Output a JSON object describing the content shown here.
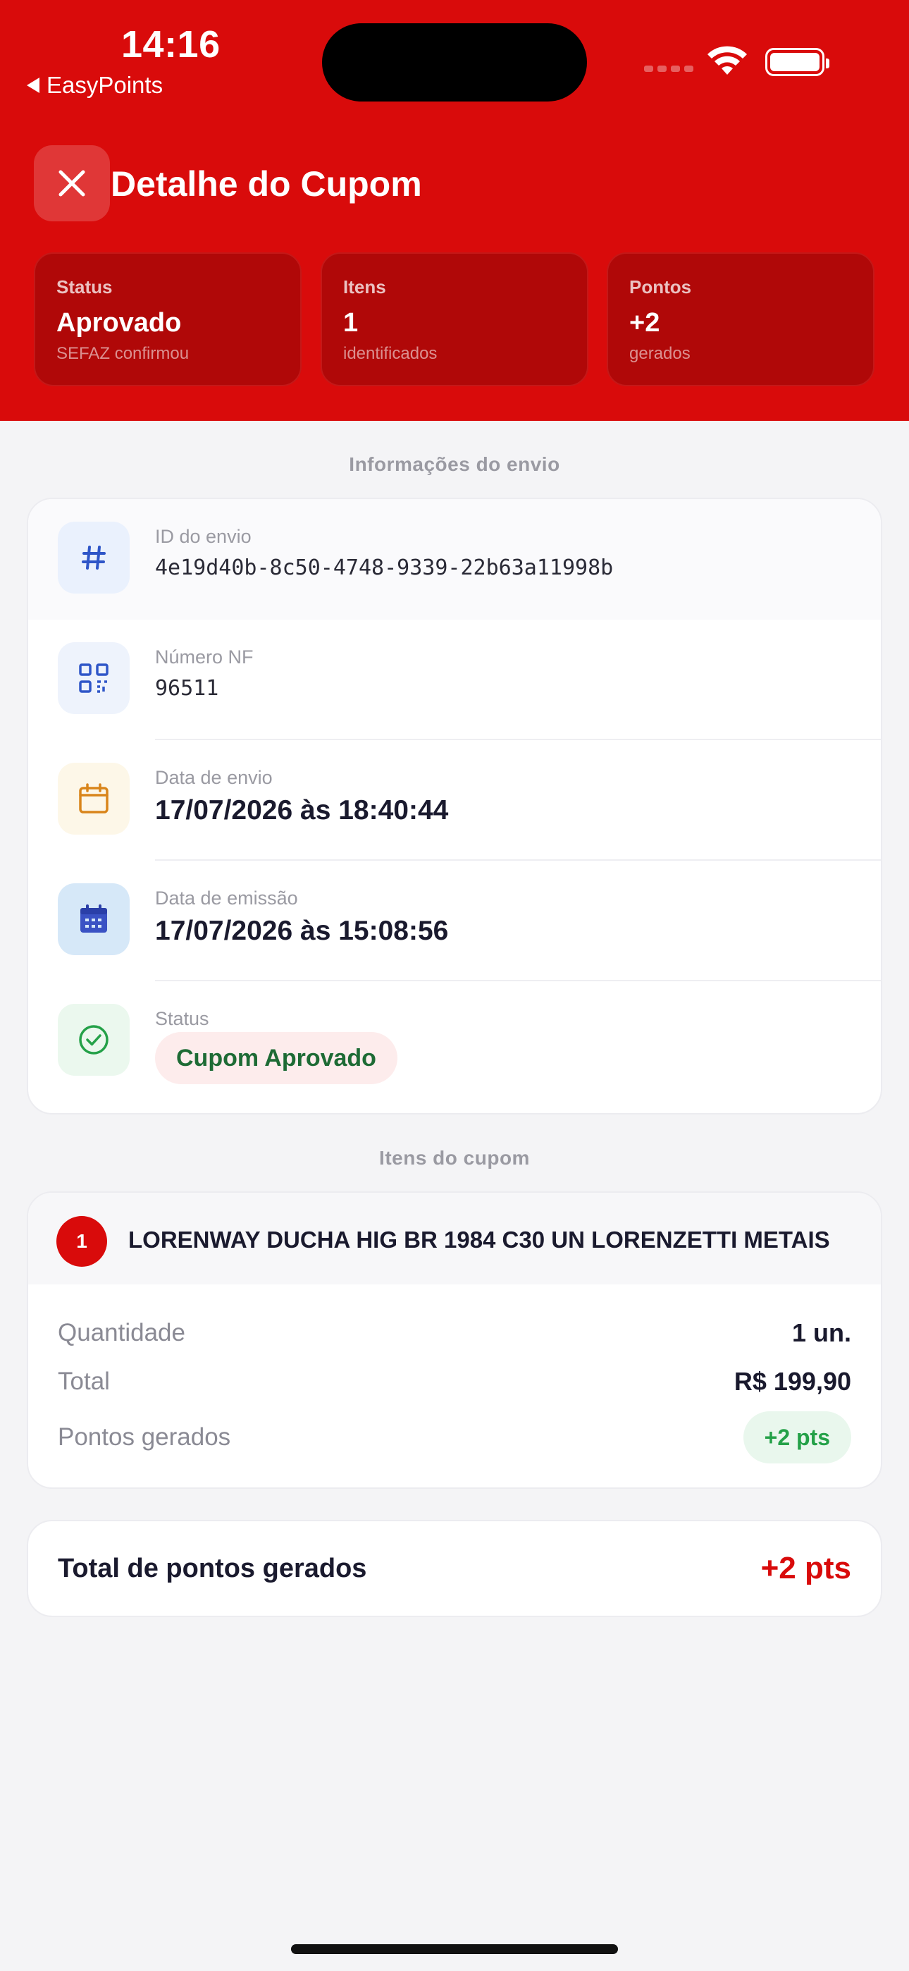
{
  "status_bar": {
    "time": "14:16",
    "back_app": "EasyPoints"
  },
  "header": {
    "title": "Detalhe do Cupom",
    "stats": [
      {
        "label": "Status",
        "value": "Aprovado",
        "sub": "SEFAZ confirmou"
      },
      {
        "label": "Itens",
        "value": "1",
        "sub": "identificados"
      },
      {
        "label": "Pontos",
        "value": "+2",
        "sub": "gerados"
      }
    ]
  },
  "info": {
    "section_title": "Informações do envio",
    "rows": [
      {
        "label": "ID do envio",
        "value": "4e19d40b-8c50-4748-9339-22b63a11998b",
        "icon": "hash-icon"
      },
      {
        "label": "Número NF",
        "value": "96511",
        "icon": "qr-code-icon"
      },
      {
        "label": "Data de envio",
        "value": "17/07/2026 às 18:40:44",
        "icon": "calendar-icon"
      },
      {
        "label": "Data de emissão",
        "value": "17/07/2026 às 15:08:56",
        "icon": "calendar-filled-icon"
      },
      {
        "label": "Status",
        "value": "Cupom Aprovado",
        "icon": "check-circle-icon"
      }
    ]
  },
  "items": {
    "section_title": "Itens do cupom",
    "list": [
      {
        "number": "1",
        "name": "LORENWAY DUCHA HIG BR 1984 C30 UN LORENZETTI METAIS",
        "quantity_label": "Quantidade",
        "quantity": "1 un.",
        "total_label": "Total",
        "total": "R$ 199,90",
        "points_label": "Pontos gerados",
        "points": "+2 pts"
      }
    ]
  },
  "summary": {
    "label": "Total de pontos gerados",
    "value": "+2 pts"
  },
  "colors": {
    "brand": "#d90b0b",
    "approved_text": "#1e6b35",
    "points_green": "#24a148"
  }
}
